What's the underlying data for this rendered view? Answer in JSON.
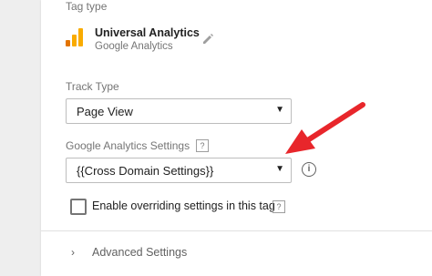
{
  "tag_type": {
    "label": "Tag type",
    "name": "Universal Analytics",
    "vendor": "Google Analytics",
    "icon": "google-analytics-icon",
    "edit_icon": "pencil-icon"
  },
  "track_type": {
    "label": "Track Type",
    "selected": "Page View"
  },
  "ga_settings": {
    "label": "Google Analytics Settings",
    "help": "?",
    "selected": "{{Cross Domain Settings}}",
    "info": "i"
  },
  "override": {
    "label": "Enable overriding settings in this tag",
    "checked": false,
    "help": "?"
  },
  "advanced": {
    "label": "Advanced Settings",
    "chevron": "›"
  },
  "colors": {
    "arrow": "#e8262b",
    "ga_orange": "#f9ab00",
    "ga_dark_orange": "#e37400"
  }
}
